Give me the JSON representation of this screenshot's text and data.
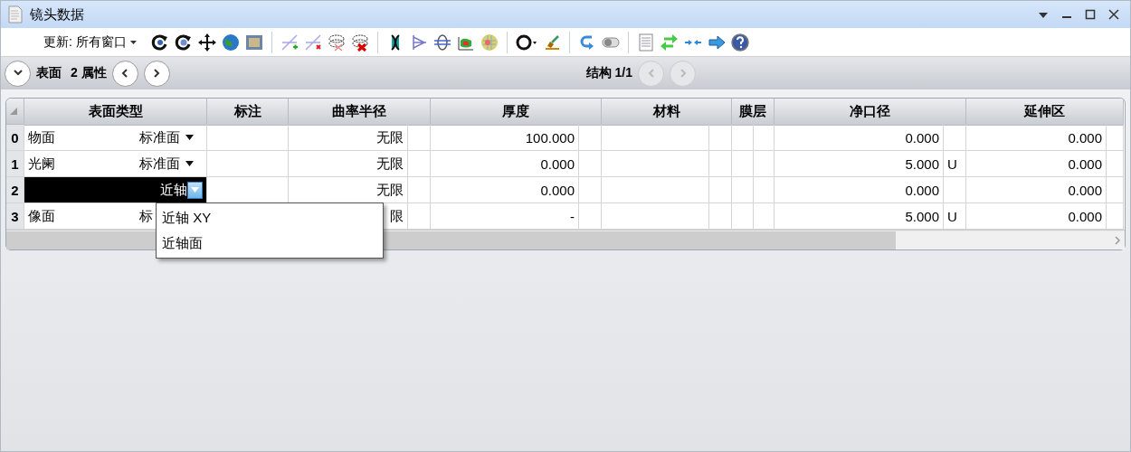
{
  "window": {
    "title": "镜头数据"
  },
  "toolbar": {
    "update_label": "更新:",
    "update_value": "所有窗口"
  },
  "nav": {
    "surface_label": "表面",
    "surface_number": "2",
    "properties_label": "属性",
    "config_label": "结构 1/1",
    "surface_buttons": [
      {
        "kind": "prev",
        "disabled": false
      },
      {
        "kind": "next",
        "disabled": false
      }
    ],
    "config_buttons": [
      {
        "kind": "prev",
        "disabled": true
      },
      {
        "kind": "next",
        "disabled": true
      }
    ]
  },
  "table": {
    "columns": [
      "表面类型",
      "标注",
      "曲率半径",
      "厚度",
      "材料",
      "膜层",
      "净口径",
      "延伸区"
    ],
    "rows": [
      {
        "number": "0",
        "selected": false,
        "name": "物面",
        "type": "标准面",
        "radius": "无限",
        "thickness": "100.000",
        "semi_diameter": "0.000",
        "extension": "0.000"
      },
      {
        "number": "1",
        "selected": false,
        "name": "光阑",
        "type": "标准面",
        "radius": "无限",
        "thickness": "0.000",
        "semi_diameter": "5.000",
        "semi_diameter_solve": "U",
        "extension": "0.000"
      },
      {
        "number": "2",
        "selected": true,
        "type": "近轴",
        "radius": "无限",
        "thickness": "0.000",
        "semi_diameter": "0.000",
        "extension": "0.000"
      },
      {
        "number": "3",
        "selected": false,
        "name": "像面",
        "type": "标",
        "radius": "限",
        "thickness": "-",
        "semi_diameter": "5.000",
        "semi_diameter_solve": "U",
        "extension": "0.000"
      }
    ]
  },
  "dropdown": {
    "options": [
      {
        "label": "近轴 XY",
        "selected": false
      },
      {
        "label": "近轴面",
        "selected": false
      }
    ]
  }
}
